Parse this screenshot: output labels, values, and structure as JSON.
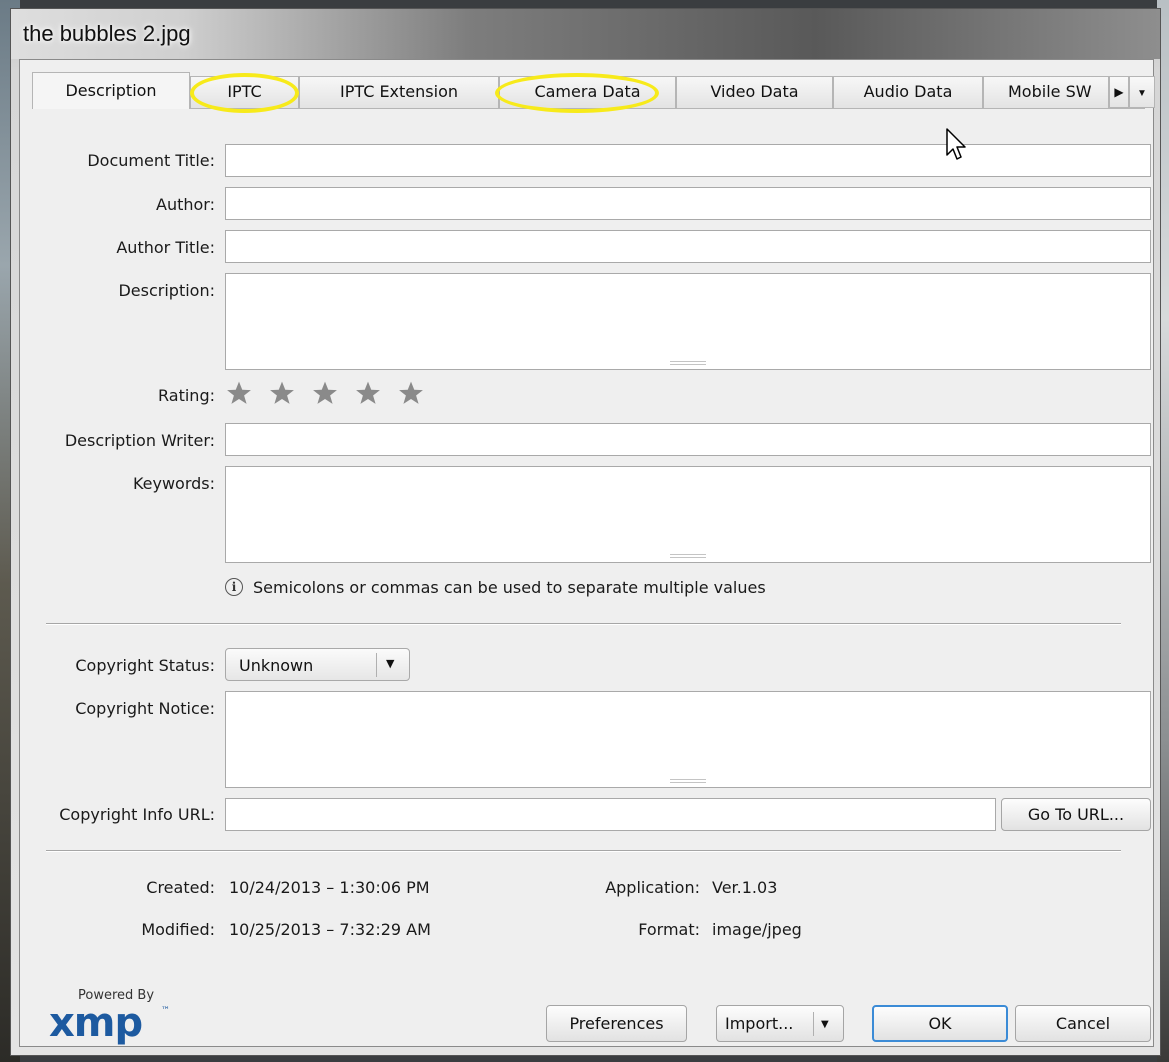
{
  "window": {
    "title": "the bubbles 2.jpg"
  },
  "tabs": [
    {
      "label": "Description",
      "active": true
    },
    {
      "label": "IPTC",
      "highlighted": true
    },
    {
      "label": "IPTC Extension"
    },
    {
      "label": "Camera Data",
      "highlighted": true
    },
    {
      "label": "Video Data"
    },
    {
      "label": "Audio Data"
    },
    {
      "label": "Mobile SW"
    }
  ],
  "tab_controls": {
    "scroll_right": "▶",
    "menu": "▼"
  },
  "highlight_color": "#f7ea1a",
  "fields": {
    "document_title": {
      "label": "Document Title:",
      "value": ""
    },
    "author": {
      "label": "Author:",
      "value": ""
    },
    "author_title": {
      "label": "Author Title:",
      "value": ""
    },
    "description": {
      "label": "Description:",
      "value": ""
    },
    "rating": {
      "label": "Rating:",
      "value": 0,
      "max": 5
    },
    "description_writer": {
      "label": "Description Writer:",
      "value": ""
    },
    "keywords": {
      "label": "Keywords:",
      "value": ""
    },
    "keywords_hint": "Semicolons or commas can be used to separate multiple values",
    "copyright_status": {
      "label": "Copyright Status:",
      "value": "Unknown"
    },
    "copyright_notice": {
      "label": "Copyright Notice:",
      "value": ""
    },
    "copyright_info_url": {
      "label": "Copyright Info URL:",
      "value": ""
    }
  },
  "buttons": {
    "go_to_url": "Go To URL...",
    "preferences": "Preferences",
    "import": "Import...",
    "ok": "OK",
    "cancel": "Cancel"
  },
  "info": {
    "created_label": "Created:",
    "created_value": "10/24/2013 – 1:30:06 PM",
    "modified_label": "Modified:",
    "modified_value": "10/25/2013 – 7:32:29 AM",
    "application_label": "Application:",
    "application_value": "Ver.1.03",
    "format_label": "Format:",
    "format_value": "image/jpeg"
  },
  "branding": {
    "powered_by": "Powered By",
    "logo": "xmp",
    "tm": "™"
  },
  "icons": [
    "info-icon",
    "star-icon",
    "chevron-down-icon",
    "arrow-right-icon",
    "mouse-pointer-icon"
  ]
}
